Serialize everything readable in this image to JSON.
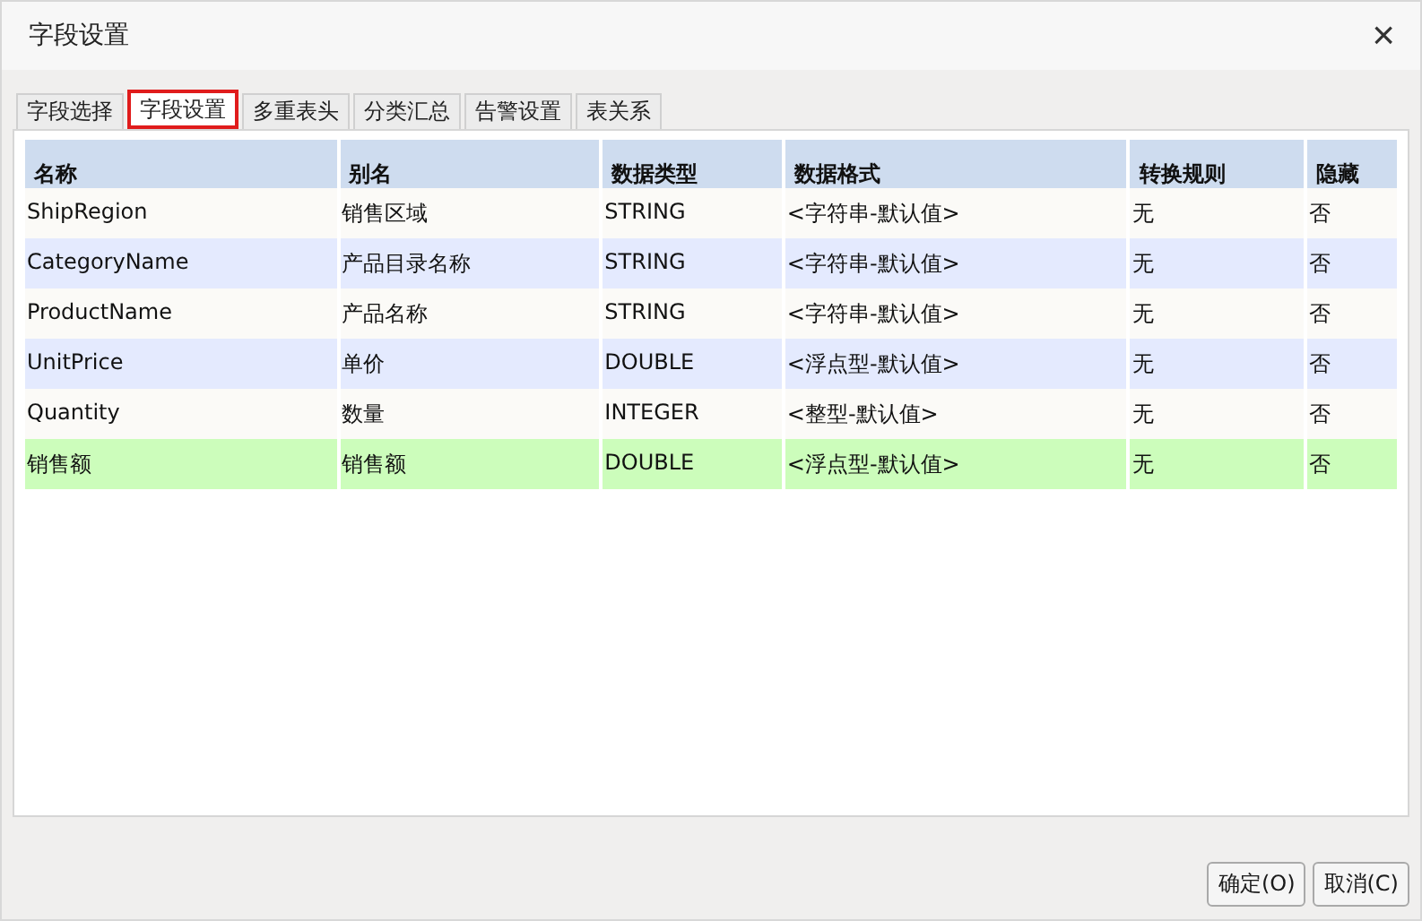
{
  "window": {
    "title": "字段设置",
    "close": "×"
  },
  "tabs": [
    {
      "label": "字段选择",
      "selected": false
    },
    {
      "label": "字段设置",
      "selected": true
    },
    {
      "label": "多重表头",
      "selected": false
    },
    {
      "label": "分类汇总",
      "selected": false
    },
    {
      "label": "告警设置",
      "selected": false
    },
    {
      "label": "表关系",
      "selected": false
    }
  ],
  "table": {
    "columns": [
      "名称",
      "别名",
      "数据类型",
      "数据格式",
      "转换规则",
      "隐藏"
    ],
    "rows": [
      {
        "cells": [
          "ShipRegion",
          "销售区域",
          "STRING",
          "<字符串-默认值>",
          "无",
          "否"
        ],
        "selected": false
      },
      {
        "cells": [
          "CategoryName",
          "产品目录名称",
          "STRING",
          "<字符串-默认值>",
          "无",
          "否"
        ],
        "selected": false
      },
      {
        "cells": [
          "ProductName",
          "产品名称",
          "STRING",
          "<字符串-默认值>",
          "无",
          "否"
        ],
        "selected": false
      },
      {
        "cells": [
          "UnitPrice",
          "单价",
          "DOUBLE",
          "<浮点型-默认值>",
          "无",
          "否"
        ],
        "selected": false
      },
      {
        "cells": [
          "Quantity",
          "数量",
          "INTEGER",
          "<整型-默认值>",
          "无",
          "否"
        ],
        "selected": false
      },
      {
        "cells": [
          "销售额",
          "销售额",
          "DOUBLE",
          "<浮点型-默认值>",
          "无",
          "否"
        ],
        "selected": true
      }
    ]
  },
  "buttons": [
    "确定(O)",
    "取消(C)"
  ]
}
